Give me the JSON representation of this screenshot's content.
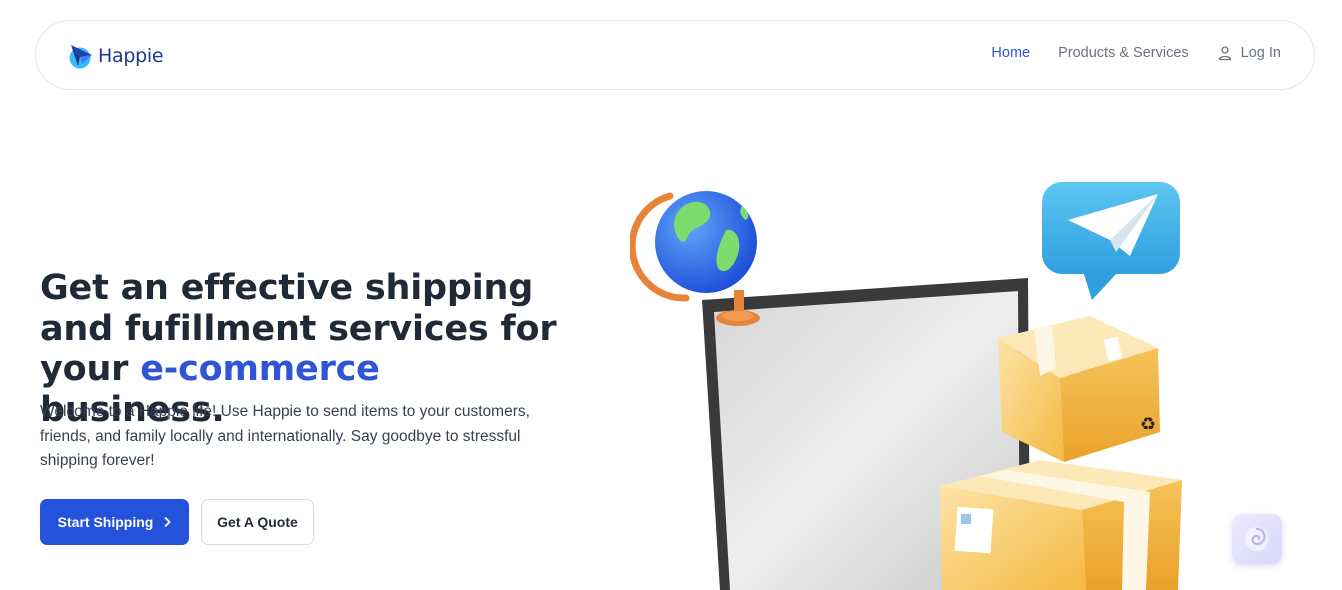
{
  "brand": {
    "name": "Happie",
    "logo_icon": "paper-plane-logo-icon"
  },
  "nav": {
    "items": [
      {
        "label": "Home",
        "active": true
      },
      {
        "label": "Products & Services",
        "active": false
      },
      {
        "label": "Log In",
        "icon": "user-icon",
        "active": false
      }
    ]
  },
  "hero": {
    "title_part1": "Get an effective shipping and fufillment services for your ",
    "title_accent": "e-commerce",
    "title_part2": " business.",
    "description": "Welcome to a Happie life! Use Happie to send items to your customers, friends, and family locally and internationally. Say goodbye to stressful shipping forever!",
    "primary_button": "Start Shipping",
    "secondary_button": "Get A Quote"
  },
  "colors": {
    "accent": "#2f55d4",
    "primary_button": "#2552db",
    "title": "#1f2937",
    "nav_text": "#6b7280"
  },
  "illustration": {
    "name": "laptop-with-globe-boxes-and-message-icon"
  },
  "chat_widget": {
    "icon": "chat-spiral-icon"
  }
}
